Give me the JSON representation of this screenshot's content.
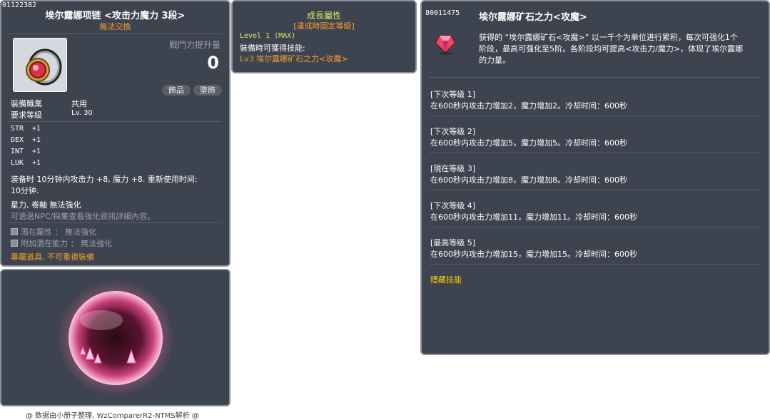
{
  "item": {
    "id": "01122382",
    "name": "埃尔露娜项链 <攻击力魔力 3段>",
    "trade": "無法交換",
    "power_label": "戰鬥力提升量",
    "power_value": "0",
    "tags": [
      "飾品",
      "墜飾"
    ],
    "job_label": "裝備職業",
    "job_value": "共用",
    "level_label": "要求等級",
    "level_value": "Lv. 30",
    "stats": [
      {
        "name": "STR",
        "value": "+1"
      },
      {
        "name": "DEX",
        "value": "+1"
      },
      {
        "name": "INT",
        "value": "+1"
      },
      {
        "name": "LUK",
        "value": "+1"
      }
    ],
    "desc_line1": "装备时 10分钟内攻击力 +8, 魔力 +8. 重新使用时间:",
    "desc_line2": "10分钟.",
    "enhance": "星力, 卷軸 無法強化",
    "npc_note": "可透過NPC/採集查看強化資訊詳細內容。",
    "potential": "潛在屬性 ： 無法強化",
    "additional": "附加潛在能力 ： 無法強化",
    "exclusive": "專屬道具, 不可重複裝備"
  },
  "growth": {
    "title": "成長屬性",
    "subtitle": "[達成時固定等級]",
    "level": "Level 1 (MAX)",
    "skill_label": "裝備時可獲得技能:",
    "skill": "Lv3 埃尔露娜矿石之力<攻魔>"
  },
  "skill": {
    "id": "80011475",
    "name": "埃尔露娜矿石之力<攻魔>",
    "desc_line1": "获得的 “埃尔露娜矿石<攻魔>” 以一千个为单位进行累积，每次可强化1个",
    "desc_line2": "阶段，最高可强化至5阶。各阶段均可提高<攻击力/魔力>，体现了埃尔露娜",
    "desc_line3": "的力量。",
    "levels": [
      {
        "header": "[下次等级 1]",
        "text": "在600秒内攻击力增加2，魔力增加2。冷却时间：600秒"
      },
      {
        "header": "[下次等级 2]",
        "text": "在600秒内攻击力增加5，魔力增加5。冷却时间：600秒"
      },
      {
        "header": "[現在等级 3]",
        "text": "在600秒内攻击力增加8，魔力增加8。冷却时间：600秒"
      },
      {
        "header": "[下次等级 4]",
        "text": "在600秒内攻击力增加11，魔力增加11。冷却时间：600秒"
      },
      {
        "header": "[最高等级 5]",
        "text": "在600秒内攻击力增加15，魔力增加15。冷却时间：600秒"
      }
    ],
    "hidden": "隱藏技能"
  },
  "footer": "@ 数据由小册子整理, WzComparerR2-NTMS解析 @",
  "colors": {
    "panel": "#3e4350",
    "border": "#8a9098",
    "orange": "#f0a030",
    "yellow": "#ffd200"
  },
  "icons": [
    "necklace-icon",
    "red-gem-icon",
    "glowing-orb-effect"
  ]
}
